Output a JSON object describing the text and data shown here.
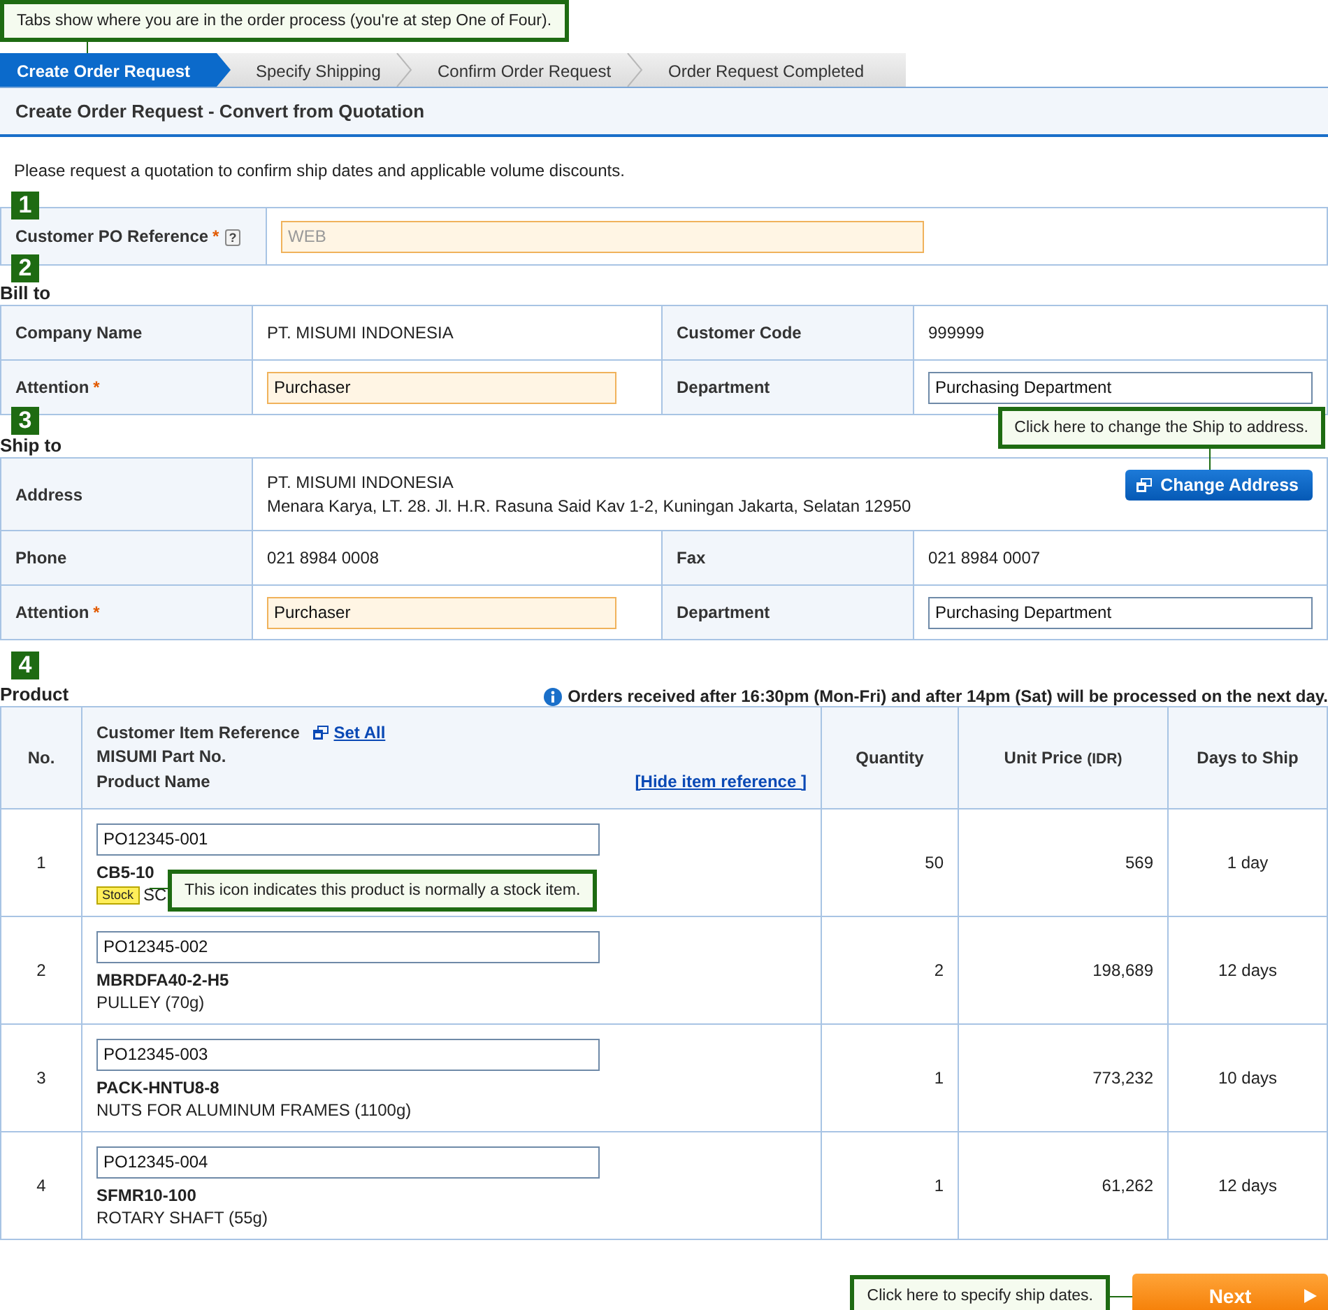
{
  "tabs_callout": "Tabs show where you are in the order process (you're at step One of Four).",
  "tabs": [
    {
      "label": "Create Order Request",
      "selected": true
    },
    {
      "label": "Specify Shipping",
      "selected": false
    },
    {
      "label": "Confirm Order Request",
      "selected": false
    },
    {
      "label": "Order Request Completed",
      "selected": false
    }
  ],
  "page_title": "Create Order Request - Convert from Quotation",
  "intro": "Please request a quotation to confirm ship dates and applicable volume discounts.",
  "po_reference": {
    "number": "1",
    "label": "Customer PO Reference",
    "required": "*",
    "help": "?",
    "placeholder": "WEB"
  },
  "bill_to": {
    "number": "2",
    "heading": "Bill to",
    "rows": [
      [
        {
          "label": "Company Name",
          "kind": "text",
          "value": "PT. MISUMI INDONESIA"
        },
        {
          "label": "Customer Code",
          "kind": "text",
          "value": "999999"
        }
      ],
      [
        {
          "label": "Attention",
          "required": "*",
          "kind": "input",
          "value": "Purchaser"
        },
        {
          "label": "Department",
          "kind": "plain_input",
          "value": "Purchasing Department"
        }
      ]
    ]
  },
  "ship_to": {
    "number": "3",
    "heading": "Ship to",
    "callout": "Click here to change the Ship to address.",
    "address": {
      "label": "Address",
      "lines": [
        "PT. MISUMI INDONESIA",
        "Menara Karya, LT. 28. Jl. H.R. Rasuna Said Kav 1-2, Kuningan Jakarta, Selatan 12950"
      ],
      "button": "Change Address"
    },
    "rows": [
      [
        {
          "label": "Phone",
          "kind": "text",
          "value": "021 8984 0008"
        },
        {
          "label": "Fax",
          "kind": "text",
          "value": "021 8984 0007"
        }
      ],
      [
        {
          "label": "Attention",
          "required": "*",
          "kind": "input",
          "value": "Purchaser"
        },
        {
          "label": "Department",
          "kind": "plain_input",
          "value": "Purchasing Department"
        }
      ]
    ]
  },
  "product": {
    "number": "4",
    "heading": "Product",
    "notice": "Orders received after 16:30pm (Mon-Fri) and after 14pm (Sat) will be processed on the next day.",
    "columns": {
      "no": "No.",
      "reference": "Customer Item Reference",
      "set_all": "Set All",
      "part_no": "MISUMI Part No.",
      "name": "Product Name",
      "hide": "[Hide item reference ]",
      "quantity": "Quantity",
      "price": "Unit Price",
      "price_unit": "(IDR)",
      "days": "Days to Ship"
    },
    "rows": [
      {
        "no": "1",
        "reference": "PO12345-001",
        "part_no": "CB5-10",
        "badge": "Stock",
        "name": "SC",
        "callout": "This icon indicates this product is normally a stock item.",
        "quantity": "50",
        "price": "569",
        "days": "1 day"
      },
      {
        "no": "2",
        "reference": "PO12345-002",
        "part_no": "MBRDFA40-2-H5",
        "name": "PULLEY (70g)",
        "quantity": "2",
        "price": "198,689",
        "days": "12 days"
      },
      {
        "no": "3",
        "reference": "PO12345-003",
        "part_no": "PACK-HNTU8-8",
        "name": "NUTS FOR ALUMINUM FRAMES (1100g)",
        "quantity": "1",
        "price": "773,232",
        "days": "10 days"
      },
      {
        "no": "4",
        "reference": "PO12345-004",
        "part_no": "SFMR10-100",
        "name": "ROTARY SHAFT (55g)",
        "quantity": "1",
        "price": "61,262",
        "days": "12 days"
      }
    ]
  },
  "footer": {
    "callout": "Click here to specify ship dates.",
    "button": "Next"
  }
}
